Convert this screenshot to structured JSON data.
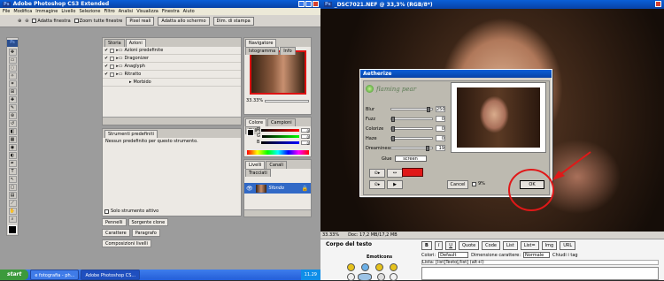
{
  "window_left": {
    "title": "Adobe Photoshop CS3 Extended",
    "app_icon": "Ps"
  },
  "menu": [
    "File",
    "Modifica",
    "Immagine",
    "Livello",
    "Selezione",
    "Filtro",
    "Analisi",
    "Visualizza",
    "Finestra",
    "Aiuto"
  ],
  "options_bar": {
    "fit_label": "Adatta finestra",
    "zoom_label": "Zoom tutte finestre",
    "btn_pixel": "Pixel reali",
    "btn_fill": "Adatta allo schermo",
    "btn_print": "Dim. di stampa"
  },
  "actions_panel": {
    "tabs": [
      "Storia",
      "Azioni"
    ],
    "items": [
      "Azioni predefinite",
      "Dragonizer",
      "Anaglyph",
      "Ritratto",
      "Morbido"
    ]
  },
  "navigator_panel": {
    "tabs": [
      "Navigatore",
      "Istogramma",
      "Info"
    ],
    "zoom": "33.33%"
  },
  "color_panel": {
    "tabs": [
      "Colore",
      "Campioni",
      "Stili"
    ],
    "channels": [
      "R",
      "G",
      "B"
    ],
    "values": [
      "0",
      "0",
      "0"
    ]
  },
  "tool_presets_panel": {
    "tab": "Strumenti predefiniti",
    "message": "Nessun predefinito per questo strumento.",
    "checkbox_label": "Solo strumento attivo"
  },
  "layers_panel": {
    "tabs": [
      "Livelli",
      "Canali",
      "Tracciati"
    ],
    "layer_name": "Sfondo"
  },
  "collapsed_panels": [
    "Pennelli",
    "Sorgente clone",
    "Carattere",
    "Paragrafo",
    "Composizioni livelli"
  ],
  "doc_window": {
    "title": "_DSC7021.NEF @ 33,3% (RGB/8*)",
    "status_zoom": "33.33%",
    "status_doc": "Doc: 17,2 MB/17,2 MB"
  },
  "plugin": {
    "title": "Aetherize",
    "brand": "flaming pear",
    "sliders": [
      {
        "label": "Blur",
        "value": "250",
        "pos": 0.96
      },
      {
        "label": "Fuzz",
        "value": "0",
        "pos": 0.0
      },
      {
        "label": "Colorize",
        "value": "0",
        "pos": 0.0
      },
      {
        "label": "Haze",
        "value": "0",
        "pos": 0.0
      },
      {
        "label": "Dreaminess",
        "value": "19",
        "pos": 0.95
      }
    ],
    "glue_label": "Glue",
    "glue_value": "screen",
    "cancel_label": "Cancel",
    "percent": "9%",
    "ok_label": "OK",
    "accent": "#e01818"
  },
  "annotation_color": "#e01818",
  "taskbar": {
    "start": "start",
    "items": [
      "e fotografia - ph...",
      "Adobe Photoshop CS..."
    ],
    "clock": "11.29"
  },
  "forum": {
    "section_title": "Corpo del testo",
    "emoticon_label": "Emoticons",
    "toolbar": [
      "B",
      "I",
      "U",
      "Quote",
      "Code",
      "List",
      "List=",
      "Img",
      "URL"
    ],
    "colori_label": "Colori:",
    "colori_value": "Default",
    "size_label": "Dimensione carattere:",
    "size_value": "Normale",
    "close_label": "Chiudi i tag",
    "list_hint": "Lista: [list]Testo[/list] (alt+l)"
  }
}
